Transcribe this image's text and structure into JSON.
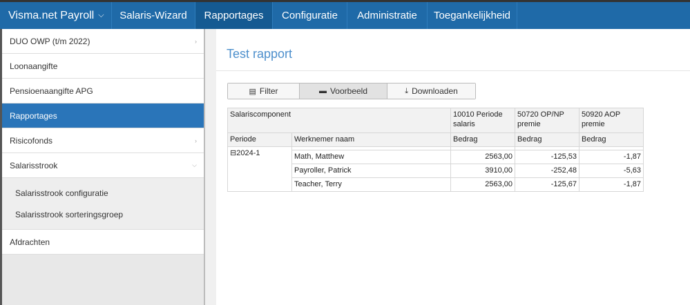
{
  "topnav": {
    "brand": "Visma.net Payroll",
    "items": [
      {
        "label": "Salaris-Wizard"
      },
      {
        "label": "Rapportages"
      },
      {
        "label": "Configuratie"
      },
      {
        "label": "Administratie"
      },
      {
        "label": "Toegankelijkheid"
      }
    ]
  },
  "sidebar": {
    "items": [
      {
        "label": "DUO OWP (t/m 2022)"
      },
      {
        "label": "Loonaangifte"
      },
      {
        "label": "Pensioenaangifte APG"
      },
      {
        "label": "Rapportages"
      },
      {
        "label": "Risicofonds"
      },
      {
        "label": "Salarisstrook"
      }
    ],
    "subitems": [
      {
        "label": "Salarisstrook configuratie"
      },
      {
        "label": "Salarisstrook sorteringsgroep"
      }
    ],
    "last": {
      "label": "Afdrachten"
    }
  },
  "main": {
    "title": "Test rapport",
    "buttons": {
      "filter": "Filter",
      "preview": "Voorbeeld",
      "download": "Downloaden"
    }
  },
  "report": {
    "header1": {
      "component": "Salariscomponent",
      "col1": "10010 Periode salaris",
      "col2": "50720 OP/NP premie",
      "col3": "50920 AOP premie"
    },
    "header2": {
      "periode": "Periode",
      "werknemer": "Werknemer naam",
      "b1": "Bedrag",
      "b2": "Bedrag",
      "b3": "Bedrag"
    },
    "group": {
      "label": "2024-1",
      "toggle": "⊟"
    },
    "rows": [
      {
        "name": "Math, Matthew",
        "v1": "2563,00",
        "v2": "-125,53",
        "v3": "-1,87"
      },
      {
        "name": "Payroller, Patrick",
        "v1": "3910,00",
        "v2": "-252,48",
        "v3": "-5,63"
      },
      {
        "name": "Teacher, Terry",
        "v1": "2563,00",
        "v2": "-125,67",
        "v3": "-1,87"
      }
    ]
  }
}
